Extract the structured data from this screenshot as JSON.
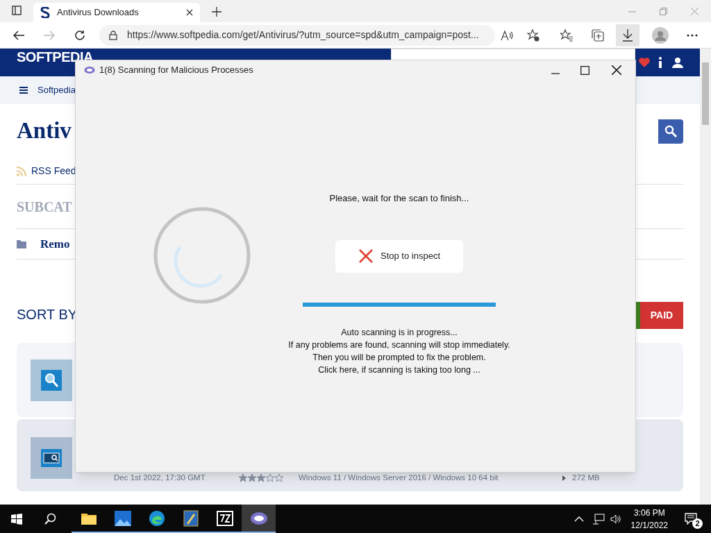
{
  "browser": {
    "tab": {
      "title": "Antivirus Downloads",
      "selected": true
    },
    "address": "https://www.softpedia.com/get/Antivirus/?utm_source=spd&utm_campaign=post..."
  },
  "page": {
    "logo": "SOFTPEDIA",
    "nav_label": "Softpedia",
    "heading": "Antiv",
    "rss": "RSS Feed",
    "subcategories": "SUBCAT",
    "subcategory": "Remo",
    "sort_by": "SORT BY",
    "filter": "PAID",
    "item": {
      "date": "Dec 1st 2022, 17:30 GMT",
      "stars": 3,
      "os": "Windows 11 / Windows Server 2016 / Windows 10 64 bit",
      "size": "272 MB"
    }
  },
  "dialog": {
    "title": "1(8) Scanning for Malicious Processes",
    "prompt": "Please, wait for the scan to finish...",
    "button": "Stop to inspect",
    "progress": {
      "level": 1
    },
    "messages": [
      "Auto scanning is in progress...",
      "If any problems are found, scanning will stop immediately.",
      "Then you will be prompted to fix the problem.",
      "Click here, if scanning is taking too long ..."
    ]
  },
  "taskbar": {
    "apps": [
      {
        "kind": "folder",
        "selected": false
      },
      {
        "kind": "photos",
        "selected": false
      },
      {
        "kind": "edge",
        "selected": false
      },
      {
        "kind": "editor",
        "selected": false
      },
      {
        "kind": "archiver",
        "selected": false
      },
      {
        "kind": "scanner",
        "selected": true
      }
    ],
    "time": "3:06 PM",
    "date": "12/1/2022",
    "notifications": "2"
  }
}
